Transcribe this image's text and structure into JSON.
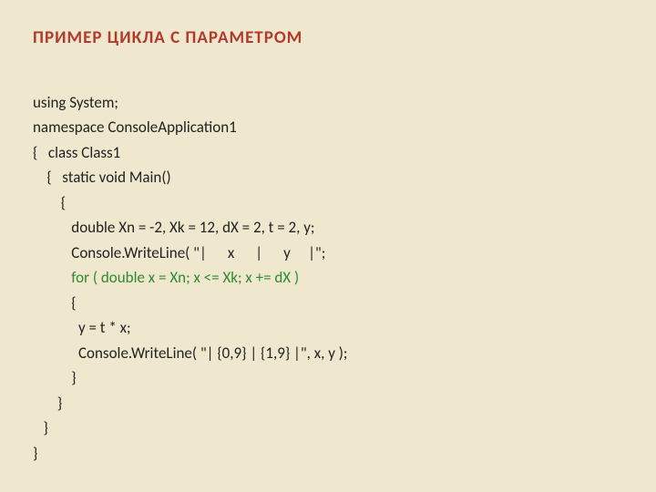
{
  "title": "ПРИМЕР ЦИКЛА С ПАРАМЕТРОМ",
  "code": {
    "l1": "using System;",
    "l2": "namespace ConsoleApplication1",
    "l3": "{   class Class1",
    "l4": "    {   static void Main()",
    "l5": "        {",
    "l6": "           double Xn = -2, Xk = 12, dX = 2, t = 2, y;",
    "l7": "           Console.WriteLine( \"|      x      |      y     |\";",
    "l8": "           for ( double x = Xn; x <= Xk; x += dX )",
    "l9": "           {",
    "l10": "             y = t * x;",
    "l11": "             Console.WriteLine( \"| {0,9} | {1,9} |\", x, y );",
    "l12": "           }",
    "l13": "       }",
    "l14": "   }",
    "l15": "}"
  }
}
